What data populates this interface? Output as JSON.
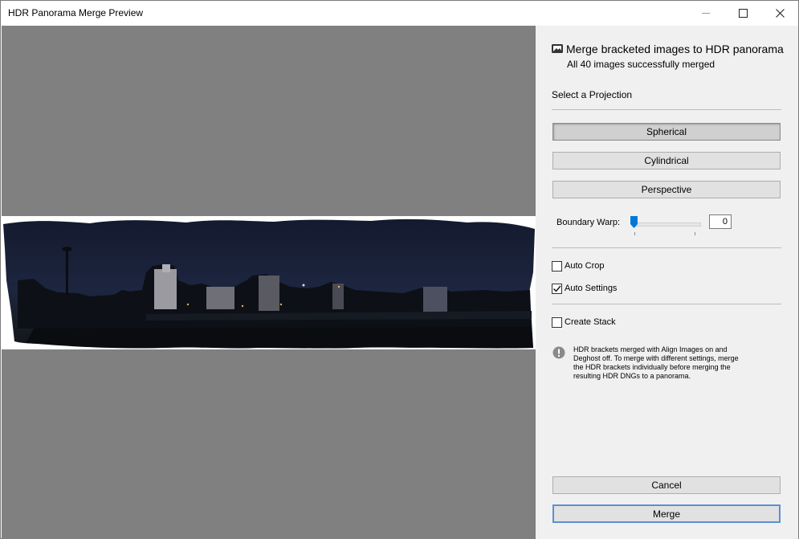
{
  "window": {
    "title": "HDR Panorama Merge Preview"
  },
  "panel": {
    "title": "Merge bracketed images to HDR panorama",
    "subtitle": "All 40 images successfully merged",
    "projection_label": "Select a Projection",
    "projections": [
      "Spherical",
      "Cylindrical",
      "Perspective"
    ],
    "selected_projection": "Spherical",
    "boundary_warp": {
      "label": "Boundary Warp:",
      "value": "0"
    },
    "auto_crop": {
      "label": "Auto Crop",
      "checked": false
    },
    "auto_settings": {
      "label": "Auto Settings",
      "checked": true
    },
    "create_stack": {
      "label": "Create Stack",
      "checked": false
    },
    "info_text": "HDR brackets merged with Align Images on and Deghost off. To merge with different settings, merge the HDR brackets individually before merging the resulting HDR DNGs to a panorama.",
    "cancel_label": "Cancel",
    "merge_label": "Merge"
  },
  "icons": {
    "title_icon": "image-icon",
    "info": "info-icon",
    "minimize": "minimize-icon",
    "maximize": "maximize-icon",
    "close": "close-icon"
  },
  "colors": {
    "preview_bg": "#808080",
    "panel_bg": "#f0f0f0",
    "slider_accent": "#0078d7",
    "default_button_border": "#5b8fd6",
    "night_sky": "#141a2e"
  }
}
